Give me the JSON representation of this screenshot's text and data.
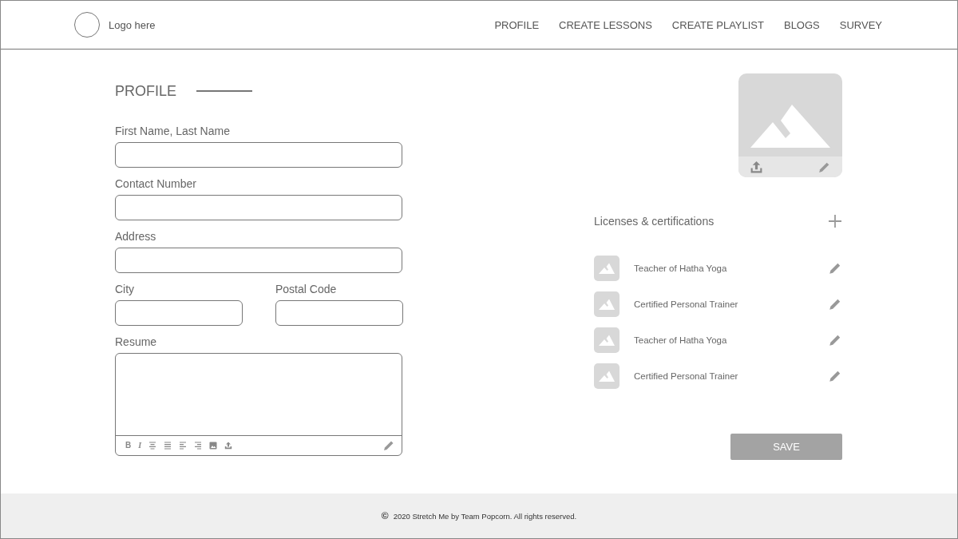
{
  "header": {
    "logo_text": "Logo here",
    "nav": [
      {
        "label": "PROFILE"
      },
      {
        "label": "CREATE LESSONS"
      },
      {
        "label": "CREATE PLAYLIST"
      },
      {
        "label": "BLOGS"
      },
      {
        "label": "SURVEY"
      }
    ]
  },
  "profile": {
    "title": "PROFILE",
    "fields": [
      {
        "label": "First Name, Last Name",
        "kind": "full"
      },
      {
        "label": "Contact Number",
        "kind": "full"
      },
      {
        "label": "Address",
        "kind": "full"
      },
      {
        "label": "City",
        "kind": "half"
      },
      {
        "label": "Postal Code",
        "kind": "half"
      }
    ],
    "resume": {
      "label": "Resume",
      "toolbar": [
        {
          "kind": "bold",
          "label": "B"
        },
        {
          "kind": "italic",
          "label": "I"
        },
        {
          "kind": "align-center"
        },
        {
          "kind": "justify"
        },
        {
          "kind": "align-left"
        },
        {
          "kind": "align-right"
        },
        {
          "kind": "image"
        },
        {
          "kind": "upload"
        }
      ]
    }
  },
  "licenses": {
    "title": "Licenses & certifications",
    "items": [
      {
        "name": "Teacher of Hatha Yoga"
      },
      {
        "name": "Certified Personal Trainer"
      },
      {
        "name": "Teacher of Hatha Yoga"
      },
      {
        "name": "Certified Personal Trainer"
      }
    ]
  },
  "save_button": "SAVE",
  "footer": {
    "symbol": "©",
    "text": "2020 Stretch Me by Team Popcorn. All rights reserved."
  }
}
